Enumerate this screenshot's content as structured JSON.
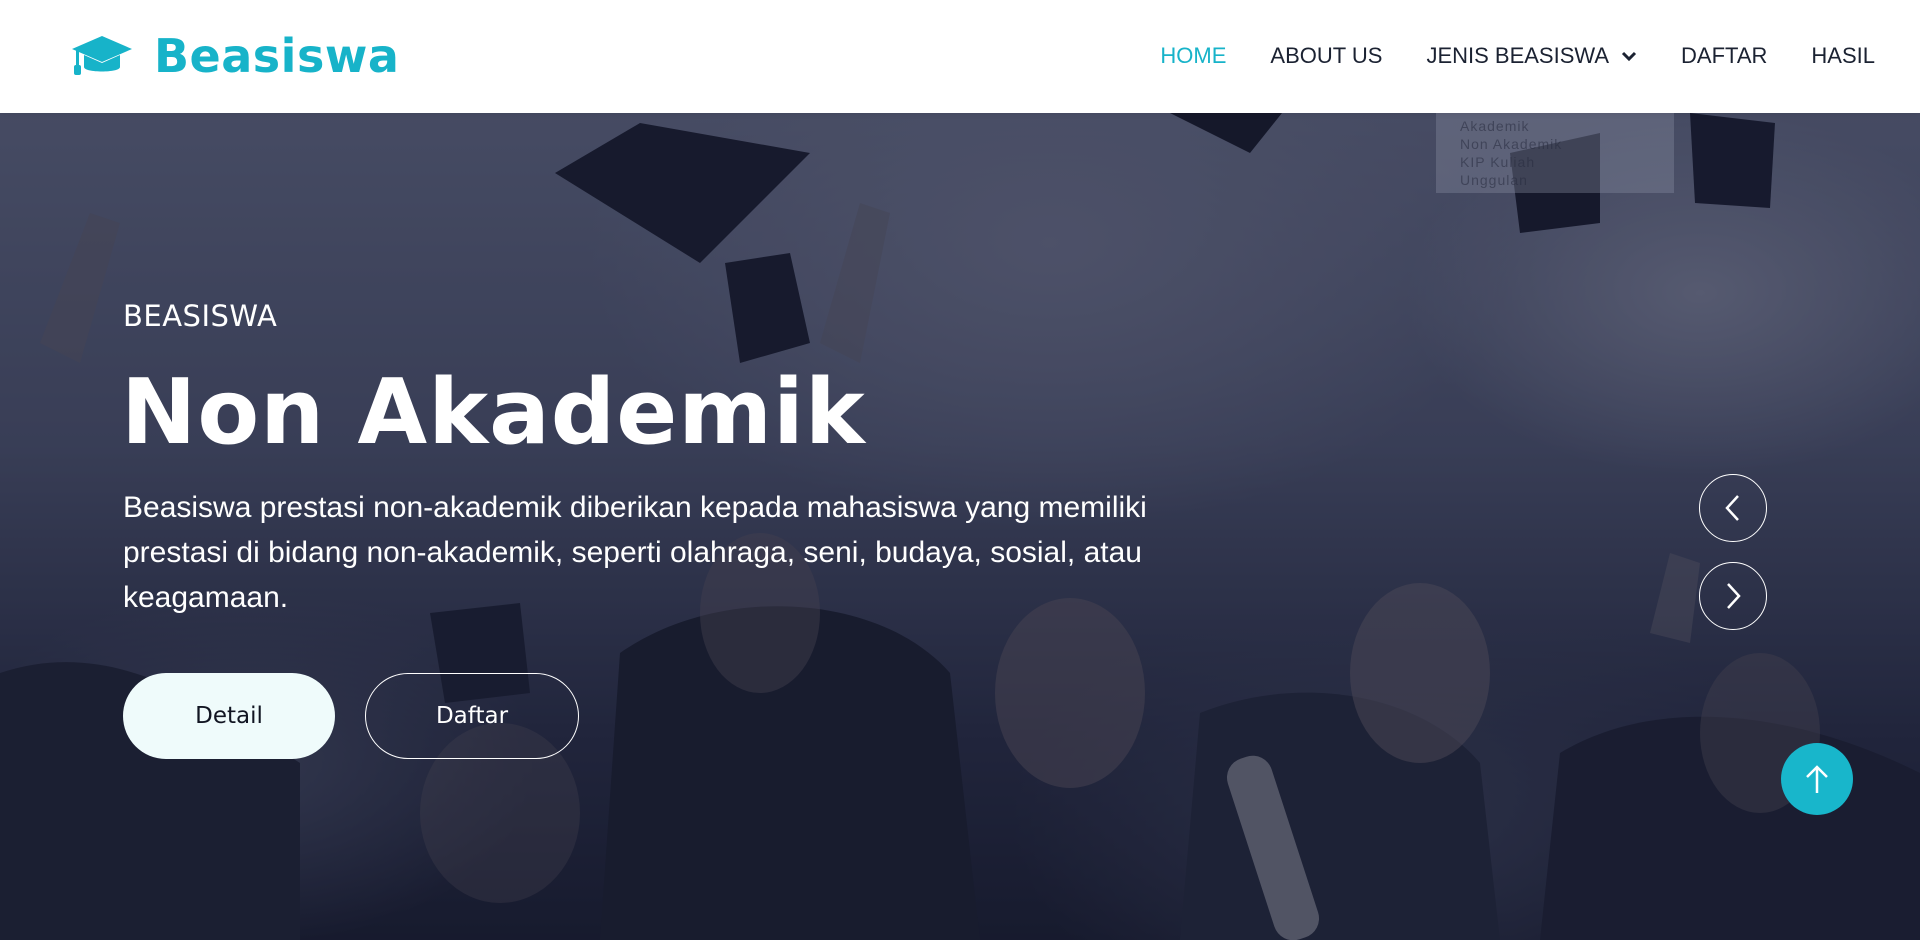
{
  "brand": {
    "name": "Beasiswa",
    "icon": "graduation-cap-icon",
    "color": "#17b3c9"
  },
  "nav": {
    "items": [
      {
        "label": "HOME",
        "active": true
      },
      {
        "label": "ABOUT US",
        "active": false
      },
      {
        "label": "JENIS BEASISWA",
        "active": false,
        "has_dropdown": true
      },
      {
        "label": "DAFTAR",
        "active": false
      },
      {
        "label": "HASIL",
        "active": false
      }
    ],
    "dropdown_items": [
      "Akademik",
      "Non Akademik",
      "KIP Kuliah",
      "Unggulan"
    ]
  },
  "hero": {
    "eyebrow": "BEASISWA",
    "title": "Non Akademik",
    "description": "Beasiswa prestasi non-akademik diberikan kepada mahasiswa yang memiliki prestasi di bidang non-akademik, seperti olahraga, seni, budaya, sosial, atau keagamaan.",
    "primary_button": "Detail",
    "secondary_button": "Daftar"
  },
  "carousel": {
    "prev_icon": "chevron-left-icon",
    "next_icon": "chevron-right-icon"
  },
  "back_to_top": {
    "icon": "arrow-up-icon",
    "color": "#18b6cb"
  },
  "colors": {
    "accent": "#17b3c9",
    "nav_text": "#1b2232",
    "hero_text": "#ffffff"
  }
}
